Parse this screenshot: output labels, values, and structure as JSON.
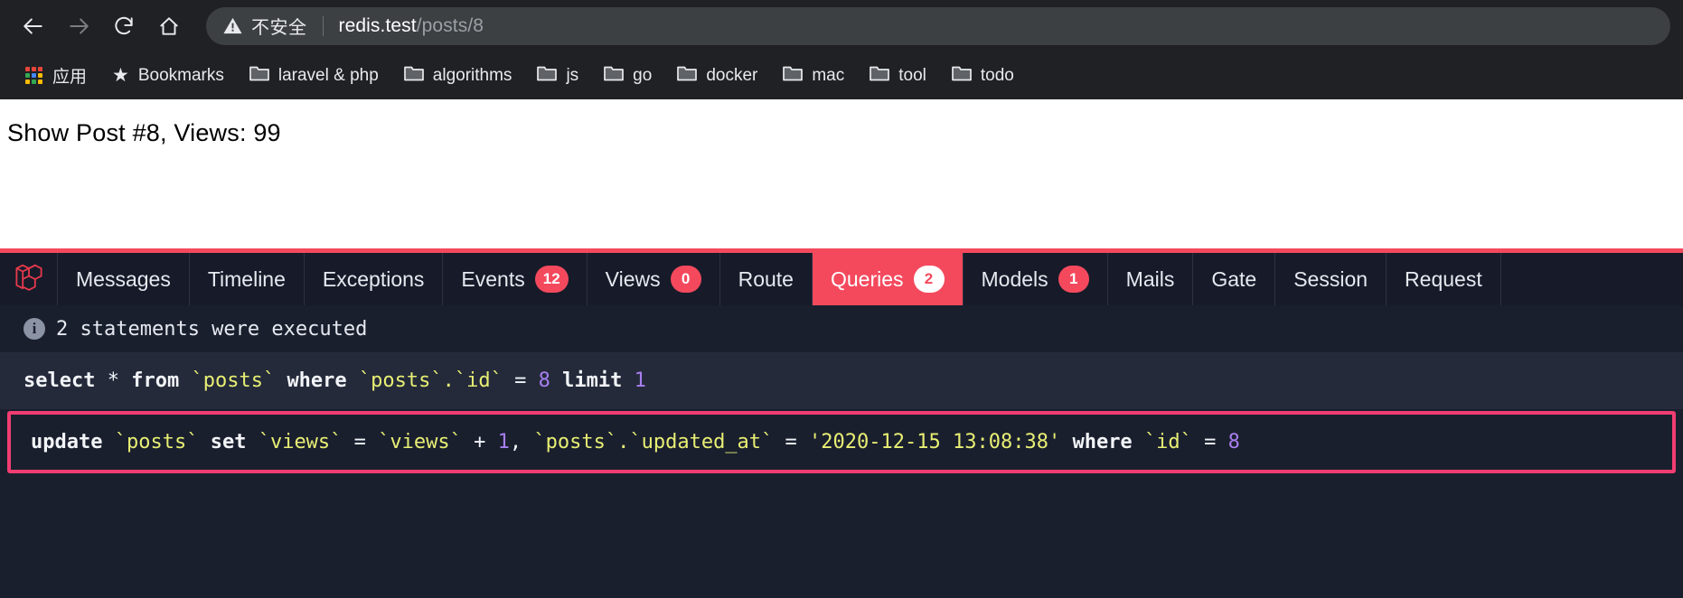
{
  "browser": {
    "nav": {
      "back": "back-arrow",
      "forward": "forward-arrow",
      "reload": "reload",
      "home": "home"
    },
    "omnibox": {
      "security_icon": "warning-triangle-icon",
      "security_label": "不安全",
      "host": "redis.test",
      "path": "/posts/8"
    },
    "bookmarks": [
      {
        "label": "应用",
        "icon": "apps-grid-icon"
      },
      {
        "label": "Bookmarks",
        "icon": "star-icon"
      },
      {
        "label": "laravel & php",
        "icon": "folder-icon"
      },
      {
        "label": "algorithms",
        "icon": "folder-icon"
      },
      {
        "label": "js",
        "icon": "folder-icon"
      },
      {
        "label": "go",
        "icon": "folder-icon"
      },
      {
        "label": "docker",
        "icon": "folder-icon"
      },
      {
        "label": "mac",
        "icon": "folder-icon"
      },
      {
        "label": "tool",
        "icon": "folder-icon"
      },
      {
        "label": "todo",
        "icon": "folder-icon"
      }
    ]
  },
  "page": {
    "content": "Show Post #8, Views: 99"
  },
  "debugbar": {
    "logo": "laravel-logo",
    "tabs": [
      {
        "label": "Messages",
        "badge": null,
        "active": false
      },
      {
        "label": "Timeline",
        "badge": null,
        "active": false
      },
      {
        "label": "Exceptions",
        "badge": null,
        "active": false
      },
      {
        "label": "Events",
        "badge": "12",
        "active": false
      },
      {
        "label": "Views",
        "badge": "0",
        "active": false
      },
      {
        "label": "Route",
        "badge": null,
        "active": false
      },
      {
        "label": "Queries",
        "badge": "2",
        "active": true
      },
      {
        "label": "Models",
        "badge": "1",
        "active": false
      },
      {
        "label": "Mails",
        "badge": null,
        "active": false
      },
      {
        "label": "Gate",
        "badge": null,
        "active": false
      },
      {
        "label": "Session",
        "badge": null,
        "active": false
      },
      {
        "label": "Request",
        "badge": null,
        "active": false
      }
    ],
    "statements_text": "2 statements were executed",
    "queries": [
      {
        "highlight": false,
        "tokens": [
          {
            "t": "select",
            "c": "kw"
          },
          {
            "t": " * ",
            "c": "op"
          },
          {
            "t": "from",
            "c": "kw"
          },
          {
            "t": " ",
            "c": "plain"
          },
          {
            "t": "`posts`",
            "c": "id"
          },
          {
            "t": " ",
            "c": "plain"
          },
          {
            "t": "where",
            "c": "kw"
          },
          {
            "t": " ",
            "c": "plain"
          },
          {
            "t": "`posts`.`id`",
            "c": "id"
          },
          {
            "t": " = ",
            "c": "op"
          },
          {
            "t": "8",
            "c": "num"
          },
          {
            "t": " ",
            "c": "plain"
          },
          {
            "t": "limit",
            "c": "kw"
          },
          {
            "t": " ",
            "c": "plain"
          },
          {
            "t": "1",
            "c": "num"
          }
        ]
      },
      {
        "highlight": true,
        "tokens": [
          {
            "t": "update",
            "c": "kw"
          },
          {
            "t": " ",
            "c": "plain"
          },
          {
            "t": "`posts`",
            "c": "id"
          },
          {
            "t": " ",
            "c": "plain"
          },
          {
            "t": "set",
            "c": "kw"
          },
          {
            "t": " ",
            "c": "plain"
          },
          {
            "t": "`views`",
            "c": "id"
          },
          {
            "t": " = ",
            "c": "op"
          },
          {
            "t": "`views`",
            "c": "id"
          },
          {
            "t": " + ",
            "c": "op"
          },
          {
            "t": "1",
            "c": "num"
          },
          {
            "t": ", ",
            "c": "op"
          },
          {
            "t": "`posts`.`updated_at`",
            "c": "id"
          },
          {
            "t": " = ",
            "c": "op"
          },
          {
            "t": "'2020-12-15 13:08:38'",
            "c": "str"
          },
          {
            "t": " ",
            "c": "plain"
          },
          {
            "t": "where",
            "c": "kw"
          },
          {
            "t": " ",
            "c": "plain"
          },
          {
            "t": "`id`",
            "c": "id"
          },
          {
            "t": " = ",
            "c": "op"
          },
          {
            "t": "8",
            "c": "num"
          }
        ]
      }
    ]
  },
  "colors": {
    "accent_red": "#f4495d",
    "highlight_pink": "#f23d72",
    "debugbar_bg": "#1a1f2e",
    "chrome_bg": "#202124"
  }
}
